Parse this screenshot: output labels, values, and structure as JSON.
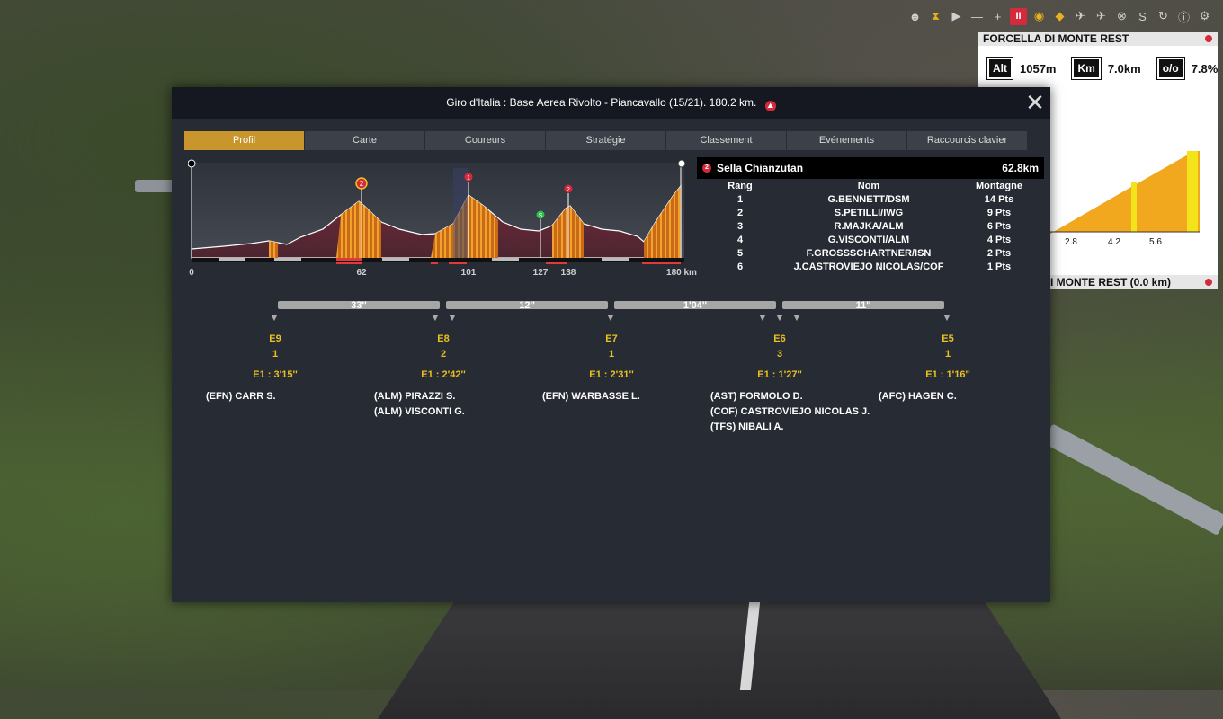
{
  "toolbar": {
    "icons": [
      "rider-icon",
      "hourglass-icon",
      "play-icon",
      "minus-icon",
      "plus-icon",
      "pause-icon",
      "eye-icon",
      "fish-icon",
      "helicopter-icon",
      "plane-icon",
      "wheel-icon",
      "s-icon",
      "refresh-icon",
      "info-icon",
      "settings-icon"
    ],
    "play": "▶",
    "minus": "—",
    "plus": "+",
    "pause": "II"
  },
  "climb_panel": {
    "title": "FORCELLA DI MONTE REST",
    "alt_label": "Alt",
    "alt_value": "1057m",
    "km_label": "Km",
    "km_value": "7.0km",
    "grade_label": "o/o",
    "grade_value": "7.8%",
    "x_ticks": [
      "2.8",
      "4.2",
      "5.6"
    ],
    "footer": "I MONTE REST  (0.0 km)"
  },
  "dialog": {
    "title": "Giro d'Italia : Base Aerea Rivolto - Piancavallo (15/21). 180.2 km.",
    "close": "✕",
    "tabs": [
      "Profil",
      "Carte",
      "Coureurs",
      "Stratégie",
      "Classement",
      "Evénements",
      "Raccourcis clavier"
    ],
    "active_tab": 0
  },
  "profile": {
    "x_labels": [
      "0",
      "62",
      "101",
      "127",
      "138",
      "180 km"
    ],
    "markers": [
      {
        "label": "2",
        "km": 62,
        "color": "#e8b21e"
      },
      {
        "label": "1",
        "km": 101,
        "color": "#d42a3c"
      },
      {
        "label": "S",
        "km": 127,
        "color": "#2fbf4a"
      },
      {
        "label": "2",
        "km": 138,
        "color": "#d42a3c"
      }
    ]
  },
  "ranking": {
    "climb_icon": "2",
    "climb_name": "Sella Chianzutan",
    "climb_km": "62.8km",
    "headers": [
      "Rang",
      "Nom",
      "Montagne"
    ],
    "rows": [
      [
        "1",
        "G.BENNETT/DSM",
        "14 Pts"
      ],
      [
        "2",
        "S.PETILLI/IWG",
        "9 Pts"
      ],
      [
        "3",
        "R.MAJKA/ALM",
        "6 Pts"
      ],
      [
        "4",
        "G.VISCONTI/ALM",
        "4 Pts"
      ],
      [
        "5",
        "F.GROSSSCHARTNER/ISN",
        "2 Pts"
      ],
      [
        "6",
        "J.CASTROVIEJO NICOLAS/COF",
        "1 Pts"
      ]
    ]
  },
  "race_groups": {
    "gap_bars": [
      "33''",
      "12''",
      "1'04''",
      "11''"
    ],
    "groups": [
      {
        "id": "E9",
        "count": "1",
        "gap": "E1 : 3'15''",
        "riders": [
          "(EFN) CARR S."
        ]
      },
      {
        "id": "E8",
        "count": "2",
        "gap": "E1 : 2'42''",
        "riders": [
          "(ALM) PIRAZZI S.",
          "(ALM) VISCONTI G."
        ]
      },
      {
        "id": "E7",
        "count": "1",
        "gap": "E1 : 2'31''",
        "riders": [
          "(EFN) WARBASSE L."
        ]
      },
      {
        "id": "E6",
        "count": "3",
        "gap": "E1 : 1'27''",
        "riders": [
          "(AST) FORMOLO D.",
          "(COF) CASTROVIEJO NICOLAS J.",
          "(TFS) NIBALI A."
        ]
      },
      {
        "id": "E5",
        "count": "1",
        "gap": "E1 : 1'16''",
        "riders": [
          "(AFC) HAGEN C."
        ]
      }
    ]
  }
}
